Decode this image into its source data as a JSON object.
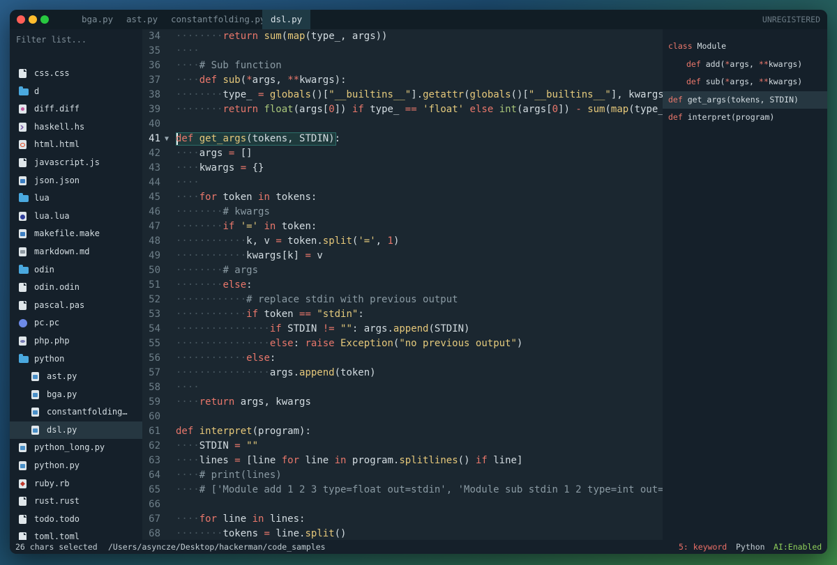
{
  "window": {
    "tabs": [
      "bga.py",
      "ast.py",
      "constantfolding.py",
      "dsl.py"
    ],
    "active_tab": 3,
    "unregistered": "UNREGISTERED"
  },
  "sidebar": {
    "filter_placeholder": "Filter list...",
    "files": [
      {
        "name": "css.css",
        "icon": "doc"
      },
      {
        "name": "d",
        "icon": "folder"
      },
      {
        "name": "diff.diff",
        "icon": "diff"
      },
      {
        "name": "haskell.hs",
        "icon": "haskell"
      },
      {
        "name": "html.html",
        "icon": "html"
      },
      {
        "name": "javascript.js",
        "icon": "doc"
      },
      {
        "name": "json.json",
        "icon": "js"
      },
      {
        "name": "lua",
        "icon": "folder"
      },
      {
        "name": "lua.lua",
        "icon": "lua"
      },
      {
        "name": "makefile.make",
        "icon": "js"
      },
      {
        "name": "markdown.md",
        "icon": "md"
      },
      {
        "name": "odin",
        "icon": "folder"
      },
      {
        "name": "odin.odin",
        "icon": "doc"
      },
      {
        "name": "pascal.pas",
        "icon": "doc"
      },
      {
        "name": "pc.pc",
        "icon": "pc"
      },
      {
        "name": "php.php",
        "icon": "php"
      },
      {
        "name": "python",
        "icon": "folder"
      },
      {
        "name": "ast.py",
        "icon": "py",
        "indent": 1
      },
      {
        "name": "bga.py",
        "icon": "py",
        "indent": 1
      },
      {
        "name": "constantfolding.py",
        "icon": "py",
        "indent": 1
      },
      {
        "name": "dsl.py",
        "icon": "py",
        "indent": 1,
        "selected": true
      },
      {
        "name": "python_long.py",
        "icon": "py"
      },
      {
        "name": "python.py",
        "icon": "py"
      },
      {
        "name": "ruby.rb",
        "icon": "ruby"
      },
      {
        "name": "rust.rust",
        "icon": "doc"
      },
      {
        "name": "todo.todo",
        "icon": "doc"
      },
      {
        "name": "toml.toml",
        "icon": "doc"
      }
    ]
  },
  "editor": {
    "current_line": 41,
    "colors": {
      "keyword": "#e9776b",
      "function": "#e6c87a",
      "string": "#e4ca7c",
      "number": "#e9776b",
      "comment": "#8a9aa3",
      "builtin": "#a9c67a",
      "text": "#d4dde2",
      "whitespace": "#46555e"
    },
    "lines": [
      {
        "n": 34,
        "i": 2,
        "t": [
          [
            "k",
            "return"
          ],
          [
            "p",
            " "
          ],
          [
            "f",
            "sum"
          ],
          [
            "p",
            "("
          ],
          [
            "f",
            "map"
          ],
          [
            "p",
            "(type_, args))"
          ]
        ]
      },
      {
        "n": 35,
        "i": 1,
        "t": []
      },
      {
        "n": 36,
        "i": 1,
        "t": [
          [
            "c",
            "# Sub function"
          ]
        ]
      },
      {
        "n": 37,
        "i": 1,
        "t": [
          [
            "k",
            "def"
          ],
          [
            "p",
            " "
          ],
          [
            "f",
            "sub"
          ],
          [
            "p",
            "("
          ],
          [
            "k",
            "*"
          ],
          [
            "p",
            "args, "
          ],
          [
            "k",
            "**"
          ],
          [
            "p",
            "kwargs):"
          ]
        ]
      },
      {
        "n": 38,
        "i": 2,
        "t": [
          [
            "p",
            "type_ "
          ],
          [
            "k",
            "="
          ],
          [
            "p",
            " "
          ],
          [
            "f",
            "globals"
          ],
          [
            "p",
            "()["
          ],
          [
            "s",
            "\"__builtins__\""
          ],
          [
            "p",
            "]."
          ],
          [
            "f",
            "getattr"
          ],
          [
            "p",
            "("
          ],
          [
            "f",
            "globals"
          ],
          [
            "p",
            "()["
          ],
          [
            "s",
            "\"__builtins__\""
          ],
          [
            "p",
            "], kwargs"
          ]
        ]
      },
      {
        "n": 39,
        "i": 2,
        "t": [
          [
            "k",
            "return"
          ],
          [
            "p",
            " "
          ],
          [
            "b",
            "float"
          ],
          [
            "p",
            "(args["
          ],
          [
            "n",
            "0"
          ],
          [
            "p",
            "]) "
          ],
          [
            "k",
            "if"
          ],
          [
            "p",
            " type_ "
          ],
          [
            "k",
            "=="
          ],
          [
            "p",
            " "
          ],
          [
            "s",
            "'float'"
          ],
          [
            "p",
            " "
          ],
          [
            "k",
            "else"
          ],
          [
            "p",
            " "
          ],
          [
            "b",
            "int"
          ],
          [
            "p",
            "(args["
          ],
          [
            "n",
            "0"
          ],
          [
            "p",
            "]) "
          ],
          [
            "k",
            "-"
          ],
          [
            "p",
            " "
          ],
          [
            "f",
            "sum"
          ],
          [
            "p",
            "("
          ],
          [
            "f",
            "map"
          ],
          [
            "p",
            "(type_"
          ]
        ]
      },
      {
        "n": 40,
        "i": 0,
        "t": []
      },
      {
        "n": 41,
        "i": 0,
        "fold": true,
        "t": [
          [
            "k",
            "def"
          ],
          [
            "p",
            " "
          ],
          [
            "f",
            "get_args"
          ],
          [
            "p",
            "(tokens, STDIN):"
          ]
        ]
      },
      {
        "n": 42,
        "i": 1,
        "t": [
          [
            "p",
            "args "
          ],
          [
            "k",
            "="
          ],
          [
            "p",
            " []"
          ]
        ]
      },
      {
        "n": 43,
        "i": 1,
        "t": [
          [
            "p",
            "kwargs "
          ],
          [
            "k",
            "="
          ],
          [
            "p",
            " {}"
          ]
        ]
      },
      {
        "n": 44,
        "i": 1,
        "t": []
      },
      {
        "n": 45,
        "i": 1,
        "t": [
          [
            "k",
            "for"
          ],
          [
            "p",
            " token "
          ],
          [
            "k",
            "in"
          ],
          [
            "p",
            " tokens:"
          ]
        ]
      },
      {
        "n": 46,
        "i": 2,
        "t": [
          [
            "c",
            "# kwargs"
          ]
        ]
      },
      {
        "n": 47,
        "i": 2,
        "t": [
          [
            "k",
            "if"
          ],
          [
            "p",
            " "
          ],
          [
            "s",
            "'='"
          ],
          [
            "p",
            " "
          ],
          [
            "k",
            "in"
          ],
          [
            "p",
            " token:"
          ]
        ]
      },
      {
        "n": 48,
        "i": 3,
        "t": [
          [
            "p",
            "k, v "
          ],
          [
            "k",
            "="
          ],
          [
            "p",
            " token."
          ],
          [
            "f",
            "split"
          ],
          [
            "p",
            "("
          ],
          [
            "s",
            "'='"
          ],
          [
            "p",
            ", "
          ],
          [
            "n",
            "1"
          ],
          [
            "p",
            ")"
          ]
        ]
      },
      {
        "n": 49,
        "i": 3,
        "t": [
          [
            "p",
            "kwargs[k] "
          ],
          [
            "k",
            "="
          ],
          [
            "p",
            " v"
          ]
        ]
      },
      {
        "n": 50,
        "i": 2,
        "t": [
          [
            "c",
            "# args"
          ]
        ]
      },
      {
        "n": 51,
        "i": 2,
        "t": [
          [
            "k",
            "else"
          ],
          [
            "p",
            ":"
          ]
        ]
      },
      {
        "n": 52,
        "i": 3,
        "t": [
          [
            "c",
            "# replace stdin with previous output"
          ]
        ]
      },
      {
        "n": 53,
        "i": 3,
        "t": [
          [
            "k",
            "if"
          ],
          [
            "p",
            " token "
          ],
          [
            "k",
            "=="
          ],
          [
            "p",
            " "
          ],
          [
            "s",
            "\"stdin\""
          ],
          [
            "p",
            ":"
          ]
        ]
      },
      {
        "n": 54,
        "i": 4,
        "t": [
          [
            "k",
            "if"
          ],
          [
            "p",
            " STDIN "
          ],
          [
            "k",
            "!="
          ],
          [
            "p",
            " "
          ],
          [
            "s",
            "\"\""
          ],
          [
            "p",
            ": args."
          ],
          [
            "f",
            "append"
          ],
          [
            "p",
            "(STDIN)"
          ]
        ]
      },
      {
        "n": 55,
        "i": 4,
        "t": [
          [
            "k",
            "else"
          ],
          [
            "p",
            ": "
          ],
          [
            "k",
            "raise"
          ],
          [
            "p",
            " "
          ],
          [
            "f",
            "Exception"
          ],
          [
            "p",
            "("
          ],
          [
            "s",
            "\"no previous output\""
          ],
          [
            "p",
            ")"
          ]
        ]
      },
      {
        "n": 56,
        "i": 3,
        "t": [
          [
            "k",
            "else"
          ],
          [
            "p",
            ":"
          ]
        ]
      },
      {
        "n": 57,
        "i": 4,
        "t": [
          [
            "p",
            "args."
          ],
          [
            "f",
            "append"
          ],
          [
            "p",
            "(token)"
          ]
        ]
      },
      {
        "n": 58,
        "i": 1,
        "t": []
      },
      {
        "n": 59,
        "i": 1,
        "t": [
          [
            "k",
            "return"
          ],
          [
            "p",
            " args, kwargs"
          ]
        ]
      },
      {
        "n": 60,
        "i": 0,
        "t": []
      },
      {
        "n": 61,
        "i": 0,
        "t": [
          [
            "k",
            "def"
          ],
          [
            "p",
            " "
          ],
          [
            "f",
            "interpret"
          ],
          [
            "p",
            "(program):"
          ]
        ]
      },
      {
        "n": 62,
        "i": 1,
        "t": [
          [
            "p",
            "STDIN "
          ],
          [
            "k",
            "="
          ],
          [
            "p",
            " "
          ],
          [
            "s",
            "\"\""
          ]
        ]
      },
      {
        "n": 63,
        "i": 1,
        "t": [
          [
            "p",
            "lines "
          ],
          [
            "k",
            "="
          ],
          [
            "p",
            " [line "
          ],
          [
            "k",
            "for"
          ],
          [
            "p",
            " line "
          ],
          [
            "k",
            "in"
          ],
          [
            "p",
            " program."
          ],
          [
            "f",
            "splitlines"
          ],
          [
            "p",
            "() "
          ],
          [
            "k",
            "if"
          ],
          [
            "p",
            " line]"
          ]
        ]
      },
      {
        "n": 64,
        "i": 1,
        "t": [
          [
            "c",
            "# print(lines)"
          ]
        ]
      },
      {
        "n": 65,
        "i": 1,
        "t": [
          [
            "c",
            "# ['Module add 1 2 3 type=float out=stdin', 'Module sub stdin 1 2 type=int out=s"
          ]
        ]
      },
      {
        "n": 66,
        "i": 0,
        "t": []
      },
      {
        "n": 67,
        "i": 1,
        "t": [
          [
            "k",
            "for"
          ],
          [
            "p",
            " line "
          ],
          [
            "k",
            "in"
          ],
          [
            "p",
            " lines:"
          ]
        ]
      },
      {
        "n": 68,
        "i": 2,
        "t": [
          [
            "p",
            "tokens "
          ],
          [
            "k",
            "="
          ],
          [
            "p",
            " line."
          ],
          [
            "f",
            "split"
          ],
          [
            "p",
            "()"
          ]
        ]
      }
    ]
  },
  "symbols": {
    "items": [
      {
        "parts": [
          [
            "k",
            "class"
          ],
          [
            "p",
            " Module"
          ]
        ],
        "indent": 0
      },
      {
        "parts": [
          [
            "k",
            "def"
          ],
          [
            "p",
            " add("
          ],
          [
            "k",
            "*"
          ],
          [
            "p",
            "args, "
          ],
          [
            "k",
            "**"
          ],
          [
            "p",
            "kwargs)"
          ]
        ],
        "indent": 1
      },
      {
        "parts": [
          [
            "k",
            "def"
          ],
          [
            "p",
            " sub("
          ],
          [
            "k",
            "*"
          ],
          [
            "p",
            "args, "
          ],
          [
            "k",
            "**"
          ],
          [
            "p",
            "kwargs)"
          ]
        ],
        "indent": 1
      },
      {
        "parts": [
          [
            "k",
            "def"
          ],
          [
            "p",
            " get_args(tokens, STDIN)"
          ]
        ],
        "indent": 0,
        "selected": true
      },
      {
        "parts": [
          [
            "k",
            "def"
          ],
          [
            "p",
            " interpret(program)"
          ]
        ],
        "indent": 0
      }
    ]
  },
  "statusbar": {
    "selection": "26 chars selected",
    "path": "/Users/asyncze/Desktop/hackerman/code_samples",
    "scope": "5: keyword",
    "syntax": "Python",
    "ai": "AI:Enabled"
  }
}
